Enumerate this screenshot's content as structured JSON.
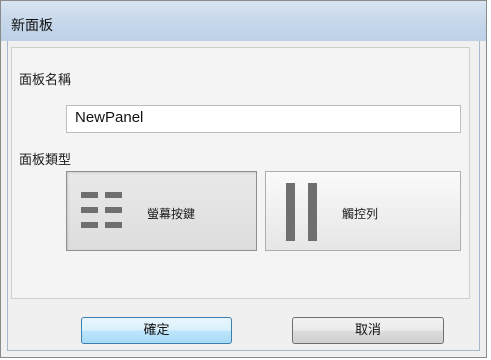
{
  "window": {
    "title": "新面板"
  },
  "form": {
    "name_label": "面板名稱",
    "name_value": "NewPanel",
    "type_label": "面板類型",
    "types": [
      {
        "label": "螢幕按鍵",
        "icon": "key-grid-icon",
        "selected": true
      },
      {
        "label": "觸控列",
        "icon": "touch-strip-icon",
        "selected": false
      }
    ]
  },
  "footer": {
    "ok_label": "確定",
    "cancel_label": "取消"
  },
  "colors": {
    "icon_gray": "#6f6f6f",
    "ok_border": "#3c7fb1"
  }
}
